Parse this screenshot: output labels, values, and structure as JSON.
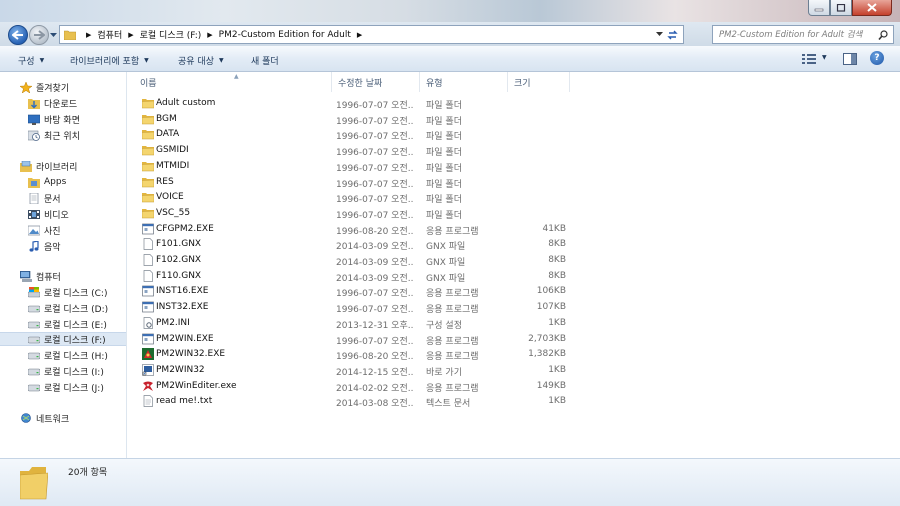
{
  "window": {
    "buttons": [
      "minimize-icon",
      "maximize-icon",
      "close-icon"
    ]
  },
  "address": {
    "crumbs": [
      "컴퓨터",
      "로컬 디스크 (F:)",
      "PM2-Custom Edition for Adult"
    ]
  },
  "search": {
    "placeholder": "PM2-Custom Edition for Adult 검색"
  },
  "toolbar": {
    "organize": "구성",
    "include_library": "라이브러리에 포함",
    "share_with": "공유 대상",
    "new_folder": "새 폴더"
  },
  "nav": {
    "favorites": {
      "label": "즐겨찾기",
      "items": [
        "다운로드",
        "바탕 화면",
        "최근 위치"
      ]
    },
    "libraries": {
      "label": "라이브러리",
      "items": [
        "Apps",
        "문서",
        "비디오",
        "사진",
        "음악"
      ]
    },
    "computer": {
      "label": "컴퓨터",
      "items": [
        "로컬 디스크 (C:)",
        "로컬 디스크 (D:)",
        "로컬 디스크 (E:)",
        "로컬 디스크 (F:)",
        "로컬 디스크 (H:)",
        "로컬 디스크 (I:)",
        "로컬 디스크 (J:)"
      ],
      "selected": "로컬 디스크 (F:)"
    },
    "network": {
      "label": "네트워크"
    }
  },
  "columns": {
    "name": "이름",
    "date": "수정한 날짜",
    "type": "유형",
    "size": "크기"
  },
  "files": [
    {
      "name": "Adult custom",
      "date": "1996-07-07 오전...",
      "type": "파일 폴더",
      "size": "",
      "icon": "folder-icon"
    },
    {
      "name": "BGM",
      "date": "1996-07-07 오전...",
      "type": "파일 폴더",
      "size": "",
      "icon": "folder-icon"
    },
    {
      "name": "DATA",
      "date": "1996-07-07 오전...",
      "type": "파일 폴더",
      "size": "",
      "icon": "folder-icon"
    },
    {
      "name": "GSMIDI",
      "date": "1996-07-07 오전...",
      "type": "파일 폴더",
      "size": "",
      "icon": "folder-icon"
    },
    {
      "name": "MTMIDI",
      "date": "1996-07-07 오전...",
      "type": "파일 폴더",
      "size": "",
      "icon": "folder-icon"
    },
    {
      "name": "RES",
      "date": "1996-07-07 오전...",
      "type": "파일 폴더",
      "size": "",
      "icon": "folder-icon"
    },
    {
      "name": "VOICE",
      "date": "1996-07-07 오전...",
      "type": "파일 폴더",
      "size": "",
      "icon": "folder-icon"
    },
    {
      "name": "VSC_55",
      "date": "1996-07-07 오전...",
      "type": "파일 폴더",
      "size": "",
      "icon": "folder-icon"
    },
    {
      "name": "CFGPM2.EXE",
      "date": "1996-08-20 오전...",
      "type": "응용 프로그램",
      "size": "41KB",
      "icon": "exe-icon"
    },
    {
      "name": "F101.GNX",
      "date": "2014-03-09 오전...",
      "type": "GNX 파일",
      "size": "8KB",
      "icon": "file-icon"
    },
    {
      "name": "F102.GNX",
      "date": "2014-03-09 오전...",
      "type": "GNX 파일",
      "size": "8KB",
      "icon": "file-icon"
    },
    {
      "name": "F110.GNX",
      "date": "2014-03-09 오전...",
      "type": "GNX 파일",
      "size": "8KB",
      "icon": "file-icon"
    },
    {
      "name": "INST16.EXE",
      "date": "1996-07-07 오전...",
      "type": "응용 프로그램",
      "size": "106KB",
      "icon": "exe-icon"
    },
    {
      "name": "INST32.EXE",
      "date": "1996-07-07 오전...",
      "type": "응용 프로그램",
      "size": "107KB",
      "icon": "exe-icon"
    },
    {
      "name": "PM2.INI",
      "date": "2013-12-31 오후...",
      "type": "구성 설정",
      "size": "1KB",
      "icon": "settings-file-icon"
    },
    {
      "name": "PM2WIN.EXE",
      "date": "1996-07-07 오전...",
      "type": "응용 프로그램",
      "size": "2,703KB",
      "icon": "exe-icon"
    },
    {
      "name": "PM2WIN32.EXE",
      "date": "1996-08-20 오전...",
      "type": "응용 프로그램",
      "size": "1,382KB",
      "icon": "game-exe-icon"
    },
    {
      "name": "PM2WIN32",
      "date": "2014-12-15 오전...",
      "type": "바로 가기",
      "size": "1KB",
      "icon": "shortcut-icon"
    },
    {
      "name": "PM2WinEditer.exe",
      "date": "2014-02-02 오전...",
      "type": "응용 프로그램",
      "size": "149KB",
      "icon": "ribbon-exe-icon"
    },
    {
      "name": "read me!.txt",
      "date": "2014-03-08 오전...",
      "type": "텍스트 문서",
      "size": "1KB",
      "icon": "text-file-icon"
    }
  ],
  "status": {
    "count": "20개 항목"
  }
}
